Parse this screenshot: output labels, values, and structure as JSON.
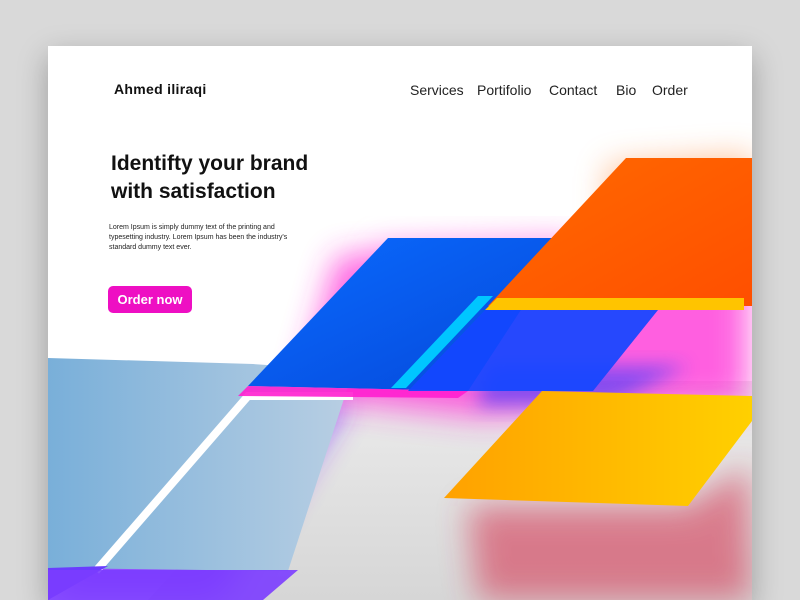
{
  "brand": {
    "name": "Ahmed iliraqi"
  },
  "nav": {
    "items": [
      {
        "label": "Services"
      },
      {
        "label": "Portifolio"
      },
      {
        "label": "Contact"
      },
      {
        "label": "Bio"
      },
      {
        "label": "Order"
      }
    ]
  },
  "hero": {
    "headline_line1": "Identifty your brand",
    "headline_line2": "with satisfaction",
    "blurb": "Lorem Ipsum is simply dummy text of the printing and typesetting industry. Lorem Ipsum has been the industry's standard dummy text ever.",
    "cta_label": "Order now"
  },
  "colors": {
    "page_background": "#d9d9d9",
    "card_background": "#ffffff",
    "cta": "#ee0fc3",
    "shape_blue": "#0a62f5",
    "shape_orange": "#ff5e00",
    "shape_yellow": "#ffb800",
    "shape_cyan": "#00c2ff",
    "shape_purple": "#7a2cff"
  }
}
